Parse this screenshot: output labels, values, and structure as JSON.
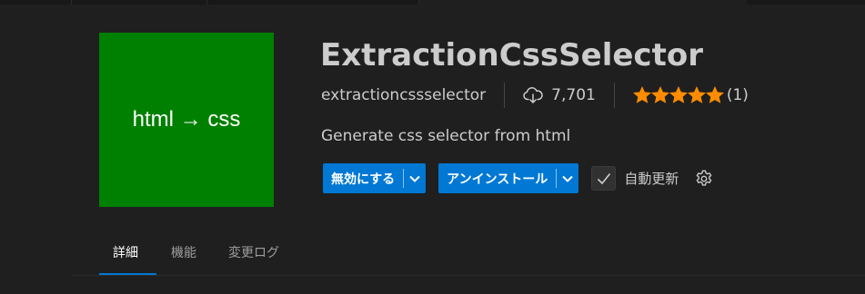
{
  "extension": {
    "logo_text": "html → css",
    "name": "ExtractionCssSelector",
    "identifier": "extractioncssselector",
    "install_count": "7,701",
    "rating_count": "(1)",
    "rating_value": 5,
    "description": "Generate css selector from html"
  },
  "actions": {
    "disable_label": "無効にする",
    "uninstall_label": "アンインストール",
    "auto_update_label": "自動更新",
    "auto_update_checked": true
  },
  "tabs": [
    {
      "label": "詳細",
      "active": true
    },
    {
      "label": "機能",
      "active": false
    },
    {
      "label": "変更ログ",
      "active": false
    }
  ],
  "colors": {
    "accent": "#0078d4",
    "logo_bg": "#008000",
    "star": "#ff8c00",
    "background": "#1f1f1f"
  },
  "icons": {
    "download": "cloud-download-icon",
    "star": "star-icon",
    "dropdown": "chevron-down-icon",
    "check": "check-icon",
    "settings": "gear-icon"
  }
}
